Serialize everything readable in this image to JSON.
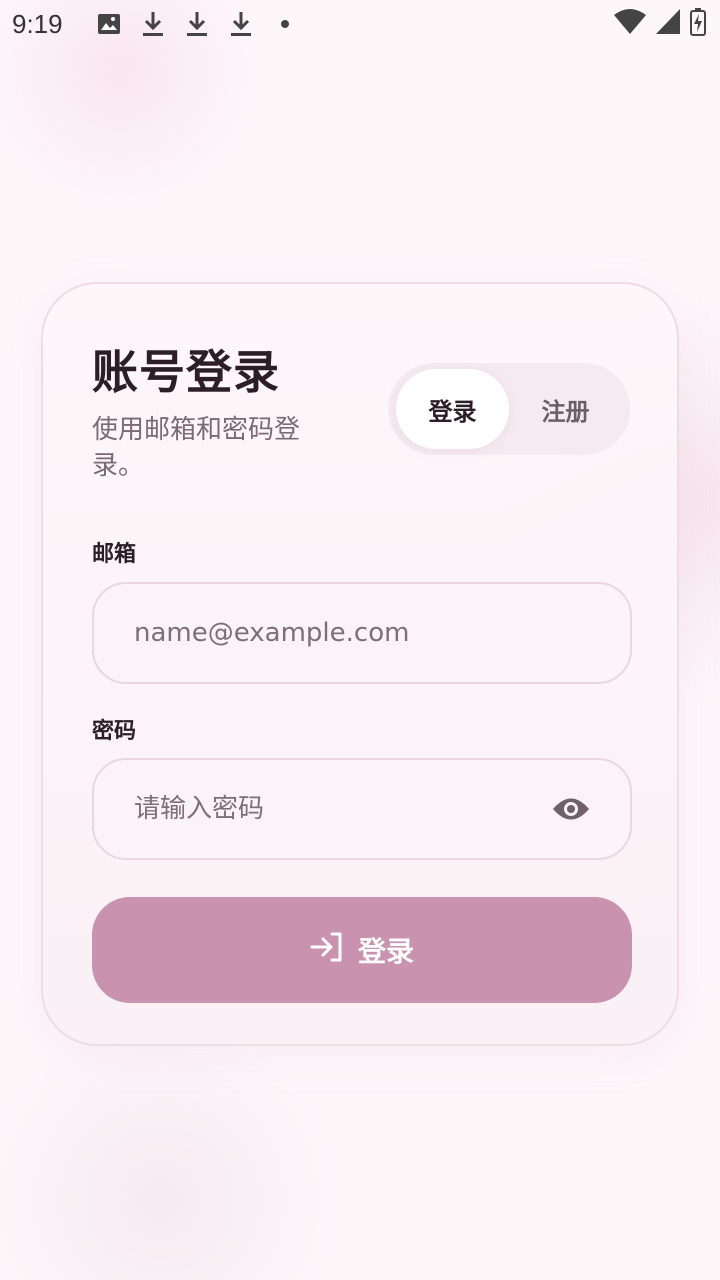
{
  "status_bar": {
    "time": "9:19",
    "notification_icons": [
      "image-icon",
      "download-icon",
      "download-icon",
      "download-icon",
      "dot-icon"
    ],
    "right_icons": [
      "wifi-icon",
      "signal-icon",
      "battery-charging-icon"
    ]
  },
  "login_card": {
    "title": "账号登录",
    "subtitle": "使用邮箱和密码登录。",
    "tabs": [
      {
        "label": "登录",
        "active": true
      },
      {
        "label": "注册",
        "active": false
      }
    ],
    "email": {
      "label": "邮箱",
      "value": "",
      "placeholder": "name@example.com"
    },
    "password": {
      "label": "密码",
      "value": "",
      "placeholder": "请输入密码",
      "visibility_icon": "eye-icon"
    },
    "submit": {
      "label": "登录",
      "icon": "login-arrow-icon"
    }
  },
  "colors": {
    "accent": "#c992ae",
    "background": "#fdf7fa",
    "card_border": "#efdbe5",
    "title_text": "#2b1f25"
  }
}
